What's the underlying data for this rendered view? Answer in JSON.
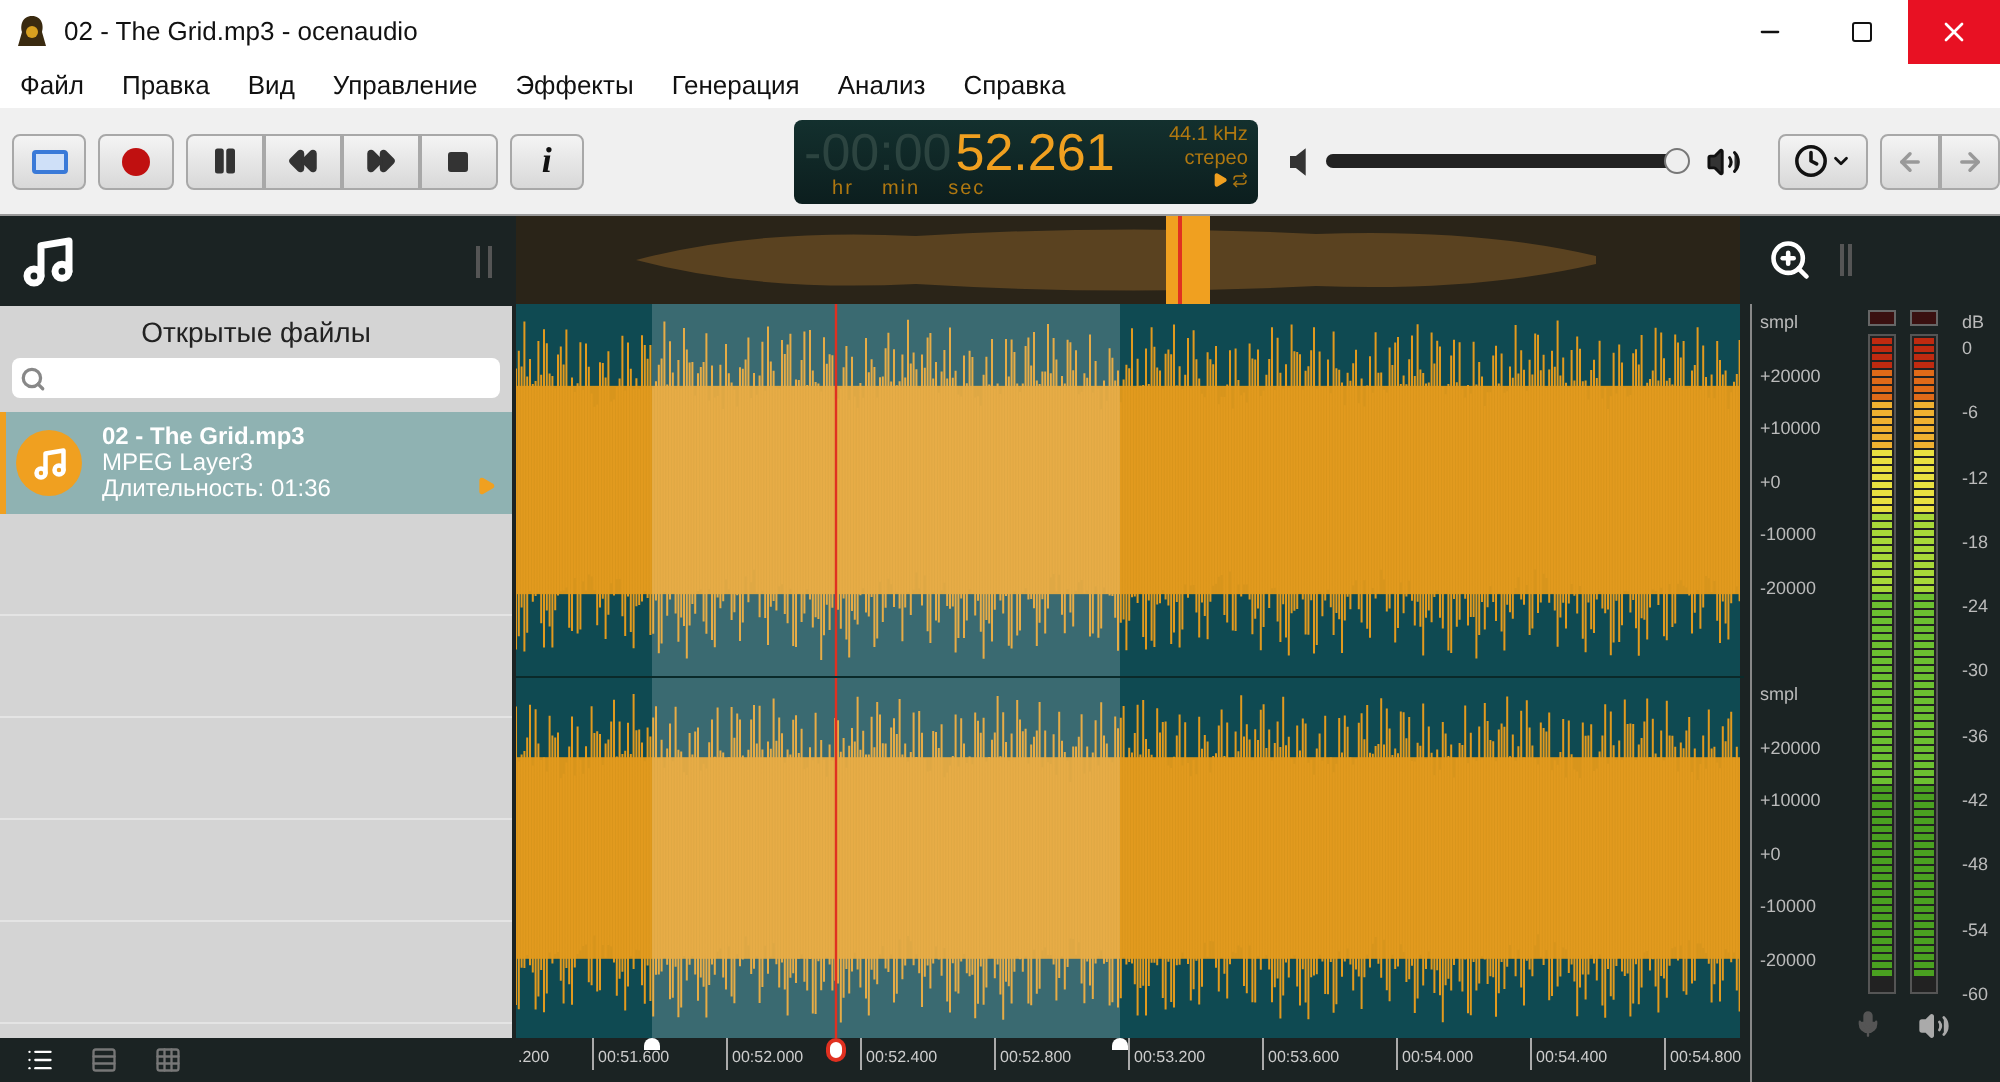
{
  "window": {
    "title": "02 - The Grid.mp3 - ocenaudio"
  },
  "menu": [
    "Файл",
    "Правка",
    "Вид",
    "Управление",
    "Эффекты",
    "Генерация",
    "Анализ",
    "Справка"
  ],
  "info_button": "i",
  "time_display": {
    "dim": "-00:00",
    "value": "52.261",
    "units": [
      "hr",
      "min",
      "sec"
    ],
    "rate": "44.1 kHz",
    "channels": "стерео"
  },
  "volume": {
    "level": 0.97
  },
  "sidebar": {
    "title": "Открытые файлы",
    "files": [
      {
        "name": "02 - The Grid.mp3",
        "format": "MPEG Layer3",
        "duration": "Длительность: 01:36",
        "selected": true
      }
    ]
  },
  "waveform": {
    "channels": [
      {
        "unit": "smpl",
        "ticks": [
          "+20000",
          "+10000",
          "+0",
          "-10000",
          "-20000"
        ]
      },
      {
        "unit": "smpl",
        "ticks": [
          "+20000",
          "+10000",
          "+0",
          "-10000",
          "-20000"
        ]
      }
    ],
    "timeline": [
      ".200",
      "00:51.600",
      "00:52.000",
      "00:52.400",
      "00:52.800",
      "00:53.200",
      "00:53.600",
      "00:54.000",
      "00:54.400",
      "00:54.800"
    ]
  },
  "meters": {
    "unit": "dB",
    "scale": [
      "0",
      "-6",
      "-12",
      "-18",
      "-24",
      "-30",
      "-36",
      "-42",
      "-48",
      "-54",
      "-60"
    ]
  },
  "view_buttons": [
    {
      "kind": "list",
      "selected": true
    },
    {
      "kind": "rows",
      "selected": false
    },
    {
      "kind": "grid",
      "selected": false
    }
  ]
}
